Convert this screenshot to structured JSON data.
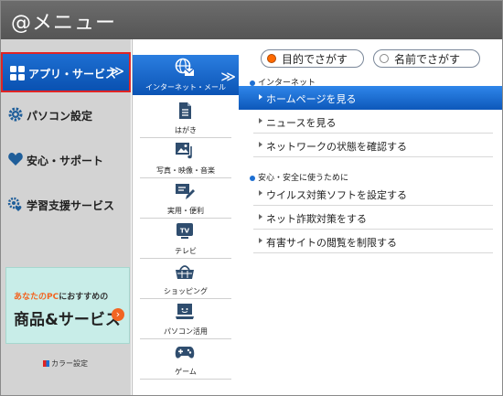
{
  "window": {
    "title": "@メニュー"
  },
  "sidebar": {
    "items": [
      {
        "label": "アプリ・サービス",
        "icon": "apps-grid-icon"
      },
      {
        "label": "パソコン設定",
        "icon": "gear-icon"
      },
      {
        "label": "安心・サポート",
        "icon": "heart-icon"
      },
      {
        "label": "学習支援サービス",
        "icon": "study-gear-icon"
      }
    ],
    "promo": {
      "line1a": "あなたのPC",
      "line1b": "におすすめの",
      "line2": "商品&サービス",
      "arrow": "›"
    },
    "color_setting": "カラー設定"
  },
  "categories": [
    {
      "label": "インターネット・メール",
      "icon": "globe-mail-icon"
    },
    {
      "label": "はがき",
      "icon": "postcard-icon"
    },
    {
      "label": "写真・映像・音楽",
      "icon": "photo-music-icon"
    },
    {
      "label": "実用・便利",
      "icon": "pen-icon"
    },
    {
      "label": "テレビ",
      "icon": "tv-icon"
    },
    {
      "label": "ショッピング",
      "icon": "basket-icon"
    },
    {
      "label": "パソコン活用",
      "icon": "pc-icon"
    },
    {
      "label": "ゲーム",
      "icon": "gamepad-icon"
    }
  ],
  "search_mode": {
    "by_purpose": "目的でさがす",
    "by_name": "名前でさがす",
    "selected": "by_purpose"
  },
  "sections": [
    {
      "title": "インターネット",
      "items": [
        "ホームページを見る",
        "ニュースを見る",
        "ネットワークの状態を確認する"
      ]
    },
    {
      "title": "安心・安全に使うために",
      "items": [
        "ウイルス対策ソフトを設定する",
        "ネット詐欺対策をする",
        "有害サイトの閲覧を制限する"
      ]
    }
  ],
  "chevron": "≫",
  "colors": {
    "accent": "#1D6FD2",
    "highlight_border": "#E02424",
    "radio_on": "#FF6A00",
    "title_bg": "#616161"
  }
}
